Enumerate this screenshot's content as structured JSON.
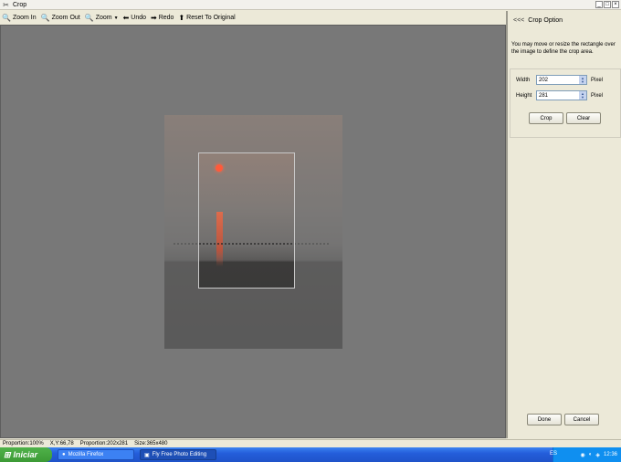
{
  "window": {
    "title": "Crop"
  },
  "toolbar": {
    "zoom_in": "Zoom In",
    "zoom_out": "Zoom Out",
    "zoom": "Zoom",
    "undo": "Undo",
    "redo": "Redo",
    "reset": "Reset To Original"
  },
  "panel": {
    "collapse": "<<<",
    "title": "Crop Option",
    "description": "You may move or resize the rectangle over the image to define the crop area.",
    "width_label": "Width",
    "width_value": "202",
    "height_label": "Height",
    "height_value": "281",
    "unit": "Pixel",
    "crop_label": "Crop",
    "clear_label": "Clear",
    "done_label": "Done",
    "cancel_label": "Cancel"
  },
  "status": {
    "proportion": "Proportion:100%",
    "xy": "X,Y:66,78",
    "crop_proportion": "Proportion:202x281",
    "size": "Size:365x480"
  },
  "taskbar": {
    "start": "Iniciar",
    "tasks": [
      "Mozilla Firefox",
      "Fly Free Photo Editing"
    ],
    "lang": "ES",
    "clock": "12:36"
  }
}
